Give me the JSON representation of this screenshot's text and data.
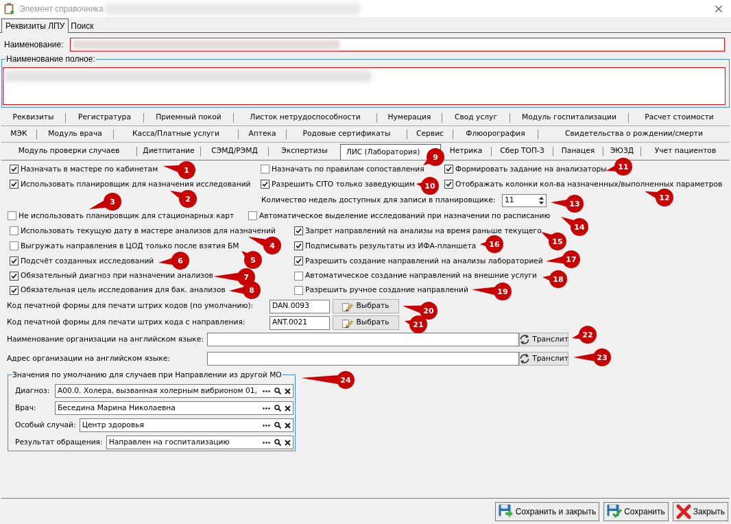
{
  "window": {
    "title": "Элемент справочника"
  },
  "tabs": [
    {
      "label": "Реквизиты ЛПУ",
      "selected": true
    },
    {
      "label": "Поиск",
      "selected": false
    }
  ],
  "name_field": {
    "label": "Наименование:",
    "invalid": true
  },
  "full_name_field": {
    "label": "Наименование полное:",
    "invalid": true
  },
  "section_tabs": [
    {
      "tabs": [
        {
          "label": "Реквизиты",
          "selected": false
        },
        {
          "label": "Регистратура",
          "selected": false
        },
        {
          "label": "Приемный покой",
          "selected": false
        },
        {
          "label": "Листок нетрудоспособности",
          "selected": false
        },
        {
          "label": "Нумерация",
          "selected": false
        },
        {
          "label": "Свод услуг",
          "selected": false
        },
        {
          "label": "Модуль госпитализации",
          "selected": false
        },
        {
          "label": "Расчет стоимости",
          "selected": false
        }
      ]
    },
    {
      "tabs": [
        {
          "label": "МЭК",
          "selected": false
        },
        {
          "label": "Модуль врача",
          "selected": false
        },
        {
          "label": "Касса/Платные услуги",
          "selected": false
        },
        {
          "label": "Аптека",
          "selected": false
        },
        {
          "label": "Родовые сертификаты",
          "selected": false
        },
        {
          "label": "Сервис",
          "selected": false
        },
        {
          "label": "Флюорография",
          "selected": false
        },
        {
          "label": "Свидетельства о рождении/смерти",
          "selected": false
        }
      ]
    },
    {
      "tabs": [
        {
          "label": "Модуль проверки случаев",
          "selected": false
        },
        {
          "label": "Диетпитание",
          "selected": false
        },
        {
          "label": "СЭМД/РЭМД",
          "selected": false
        },
        {
          "label": "Экспертизы",
          "selected": false
        },
        {
          "label": "ЛИС (Лаборатория)",
          "selected": true
        },
        {
          "label": "Нетрика",
          "selected": false
        },
        {
          "label": "Сбер ТОП-3",
          "selected": false
        },
        {
          "label": "Панацея",
          "selected": false
        },
        {
          "label": "ЭЮЗД",
          "selected": false
        },
        {
          "label": "Учет пациентов",
          "selected": false
        }
      ]
    }
  ],
  "settings_rows": [
    {
      "items": [
        {
          "kind": "checkbox",
          "label": "Назначать в мастере по кабинетам",
          "checked": true
        },
        {
          "kind": "checkbox",
          "label": "Назначать по правилам сопоставления",
          "checked": false
        },
        {
          "kind": "checkbox",
          "label": "Формировать задание на анализаторы",
          "checked": true
        }
      ]
    },
    {
      "items": [
        {
          "kind": "checkbox",
          "label": "Использовать планировщик для назначения исследований",
          "checked": true
        },
        {
          "kind": "checkbox",
          "label": "Разрешить CITO только заведующим",
          "checked": true
        },
        {
          "kind": "checkbox",
          "label": "Отображать колонки кол-ва назначенных/выполненных параметров",
          "checked": true
        }
      ]
    },
    {
      "items": [
        {
          "kind": "spinner",
          "label": "Количество недель доступных для записи в планировщике:",
          "value": "11"
        }
      ]
    },
    {
      "items": [
        {
          "kind": "checkbox",
          "label": "Не использовать планировщик для стационарных карт",
          "checked": false
        },
        {
          "kind": "checkbox",
          "label": "Автоматическое выделение исследований при назначении по расписанию",
          "checked": false
        }
      ]
    },
    {
      "items": [
        {
          "kind": "checkbox",
          "label": "Использовать текущую дату в мастере анализов для назначений",
          "checked": false
        },
        {
          "kind": "checkbox",
          "label": "Запрет направлений на анализы на время раньше текущего",
          "checked": true
        }
      ]
    },
    {
      "items": [
        {
          "kind": "checkbox",
          "label": "Выгружать направления в ЦОД только после взятия БМ",
          "checked": false
        },
        {
          "kind": "checkbox",
          "label": "Подписывать результаты из ИФА-планшета",
          "checked": true
        }
      ]
    },
    {
      "items": [
        {
          "kind": "checkbox",
          "label": "Подсчёт созданных исследований",
          "checked": true
        },
        {
          "kind": "checkbox",
          "label": "Разрешить создание направлений на анализы лабораторией",
          "checked": true
        }
      ]
    },
    {
      "items": [
        {
          "kind": "checkbox",
          "label": "Обязательный диагноз при назначении анализов",
          "checked": true
        },
        {
          "kind": "checkbox",
          "label": "Автоматическое создание направлений на внешние услуги",
          "checked": false
        }
      ]
    },
    {
      "items": [
        {
          "kind": "checkbox",
          "label": "Обязательная цель исследования для бак. анализов",
          "checked": true
        },
        {
          "kind": "checkbox",
          "label": "Разрешить ручное создание направлений",
          "checked": false
        }
      ]
    }
  ],
  "print_forms": [
    {
      "label": "Код печатной формы для печати штрих кодов (по умолчанию):",
      "value": "DAN.0093",
      "button": "Выбрать"
    },
    {
      "label": "Код печатной формы для печати штрих кода с направления:",
      "value": "ANT.0021",
      "button": "Выбрать"
    }
  ],
  "english_fields": [
    {
      "label": "Наименование организации на английском языке:",
      "button": "Транслит"
    },
    {
      "label": "Адрес организации на английском языке:",
      "button": "Транслит"
    }
  ],
  "default_values": {
    "title": "Значения по умолчанию для случаев при Направлении из другой МО",
    "fields": [
      {
        "label": "Диагноз:",
        "value": "A00.0. Холера, вызванная холерным вибрионом 01,"
      },
      {
        "label": "Врач:",
        "value": "Беседина Марина Николаевна"
      },
      {
        "label": "Особый случай:",
        "value": "Центр здоровья"
      },
      {
        "label": "Результат обращения:",
        "value": "Направлен на госпитализацию"
      }
    ]
  },
  "footer_buttons": [
    {
      "kind": "save_close",
      "label": "Сохранить и закрыть"
    },
    {
      "kind": "save",
      "label": "Сохранить"
    },
    {
      "kind": "close",
      "label": "Закрыть"
    }
  ],
  "annotations": [
    {
      "label": "1"
    },
    {
      "label": "2"
    },
    {
      "label": "3"
    },
    {
      "label": "4"
    },
    {
      "label": "6"
    },
    {
      "label": "5"
    },
    {
      "label": "7"
    },
    {
      "label": "8"
    },
    {
      "label": "9"
    },
    {
      "label": "10"
    },
    {
      "label": "11"
    },
    {
      "label": "12"
    },
    {
      "label": "13"
    },
    {
      "label": "14"
    },
    {
      "label": "15"
    },
    {
      "label": "16"
    },
    {
      "label": "17"
    },
    {
      "label": "18"
    },
    {
      "label": "19"
    },
    {
      "label": "20"
    },
    {
      "label": "21"
    },
    {
      "label": "22"
    },
    {
      "label": "23"
    },
    {
      "label": "24"
    }
  ]
}
